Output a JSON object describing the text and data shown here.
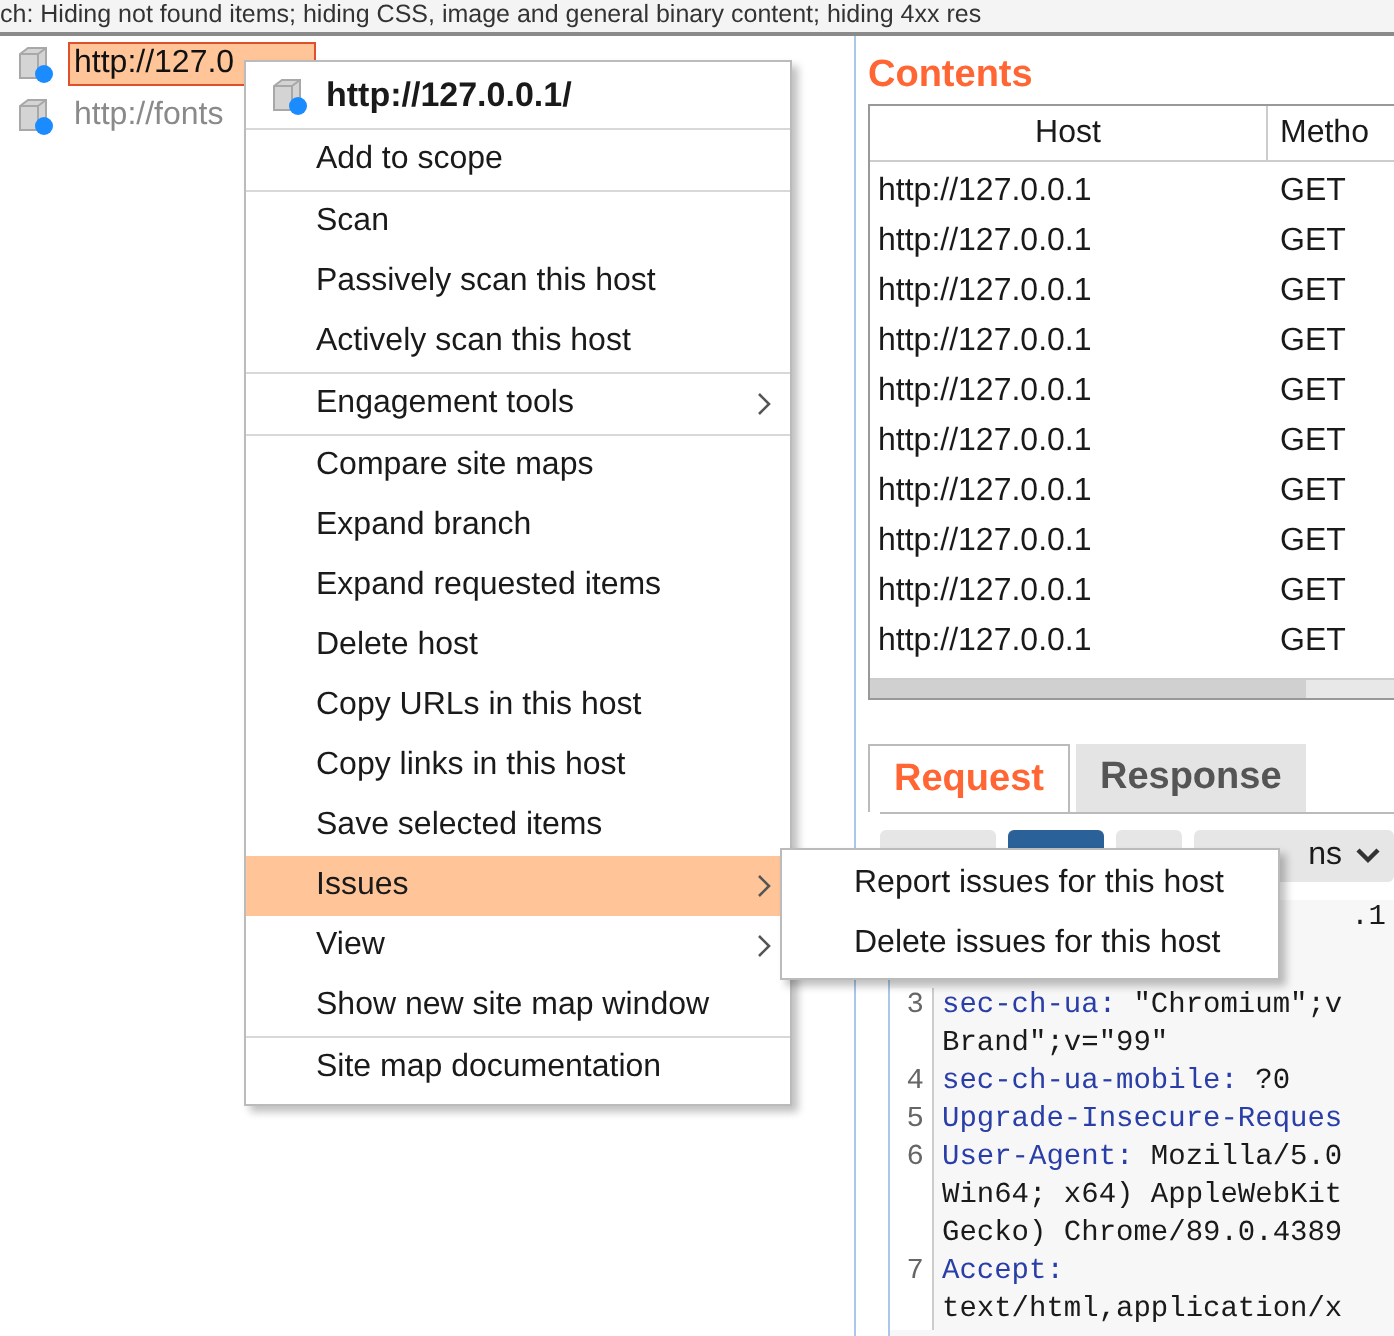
{
  "filter_bar": {
    "text": "ch: Hiding not found items;  hiding CSS, image and general binary content;  hiding 4xx res"
  },
  "site_tree": {
    "items": [
      {
        "label": "http://127.0",
        "selected": true,
        "in_scope": true
      },
      {
        "label": "http://fonts",
        "selected": false,
        "in_scope": false
      }
    ]
  },
  "contents": {
    "title": "Contents",
    "columns": [
      "Host",
      "Metho"
    ],
    "rows": [
      [
        "http://127.0.0.1",
        "GET"
      ],
      [
        "http://127.0.0.1",
        "GET"
      ],
      [
        "http://127.0.0.1",
        "GET"
      ],
      [
        "http://127.0.0.1",
        "GET"
      ],
      [
        "http://127.0.0.1",
        "GET"
      ],
      [
        "http://127.0.0.1",
        "GET"
      ],
      [
        "http://127.0.0.1",
        "GET"
      ],
      [
        "http://127.0.0.1",
        "GET"
      ],
      [
        "http://127.0.0.1",
        "GET"
      ],
      [
        "http://127.0.0.1",
        "GET"
      ]
    ]
  },
  "message_tabs": [
    {
      "label": "Request",
      "selected": true
    },
    {
      "label": "Response",
      "selected": false
    }
  ],
  "toolbar": {
    "actions_label": "ns"
  },
  "request_first_line": ".1",
  "request_lines": [
    {
      "num": "3",
      "key": "sec-ch-ua:",
      "value": " \"Chromium\";v",
      "continuation": [
        "Brand\";v=\"99\""
      ]
    },
    {
      "num": "4",
      "key": "sec-ch-ua-mobile:",
      "value": " ?0"
    },
    {
      "num": "5",
      "key": "Upgrade-Insecure-Reques"
    },
    {
      "num": "6",
      "key": "User-Agent:",
      "value": " Mozilla/5.0",
      "continuation": [
        "Win64; x64) AppleWebKit",
        "Gecko) Chrome/89.0.4389"
      ]
    },
    {
      "num": "7",
      "key": "Accept:",
      "continuation": [
        "text/html,application/x"
      ]
    }
  ],
  "context_menu": {
    "header": "http://127.0.0.1/",
    "groups": [
      [
        {
          "label": "Add to scope",
          "selected": false,
          "submenu": false
        }
      ],
      [
        {
          "label": "Scan",
          "selected": false,
          "submenu": false
        },
        {
          "label": "Passively scan this host",
          "selected": false,
          "submenu": false
        },
        {
          "label": "Actively scan this host",
          "selected": false,
          "submenu": false
        }
      ],
      [
        {
          "label": "Engagement tools",
          "selected": false,
          "submenu": true
        }
      ],
      [
        {
          "label": "Compare site maps",
          "selected": false,
          "submenu": false
        },
        {
          "label": "Expand branch",
          "selected": false,
          "submenu": false
        },
        {
          "label": "Expand requested items",
          "selected": false,
          "submenu": false
        },
        {
          "label": "Delete host",
          "selected": false,
          "submenu": false
        },
        {
          "label": "Copy URLs in this host",
          "selected": false,
          "submenu": false
        },
        {
          "label": "Copy links in this host",
          "selected": false,
          "submenu": false
        },
        {
          "label": "Save selected items",
          "selected": false,
          "submenu": false
        },
        {
          "label": "Issues",
          "selected": true,
          "submenu": true
        },
        {
          "label": "View",
          "selected": false,
          "submenu": true
        },
        {
          "label": "Show new site map window",
          "selected": false,
          "submenu": false
        }
      ],
      [
        {
          "label": "Site map documentation",
          "selected": false,
          "submenu": false
        }
      ]
    ]
  },
  "submenu": {
    "items": [
      "Report issues for this host",
      "Delete issues for this host"
    ]
  }
}
